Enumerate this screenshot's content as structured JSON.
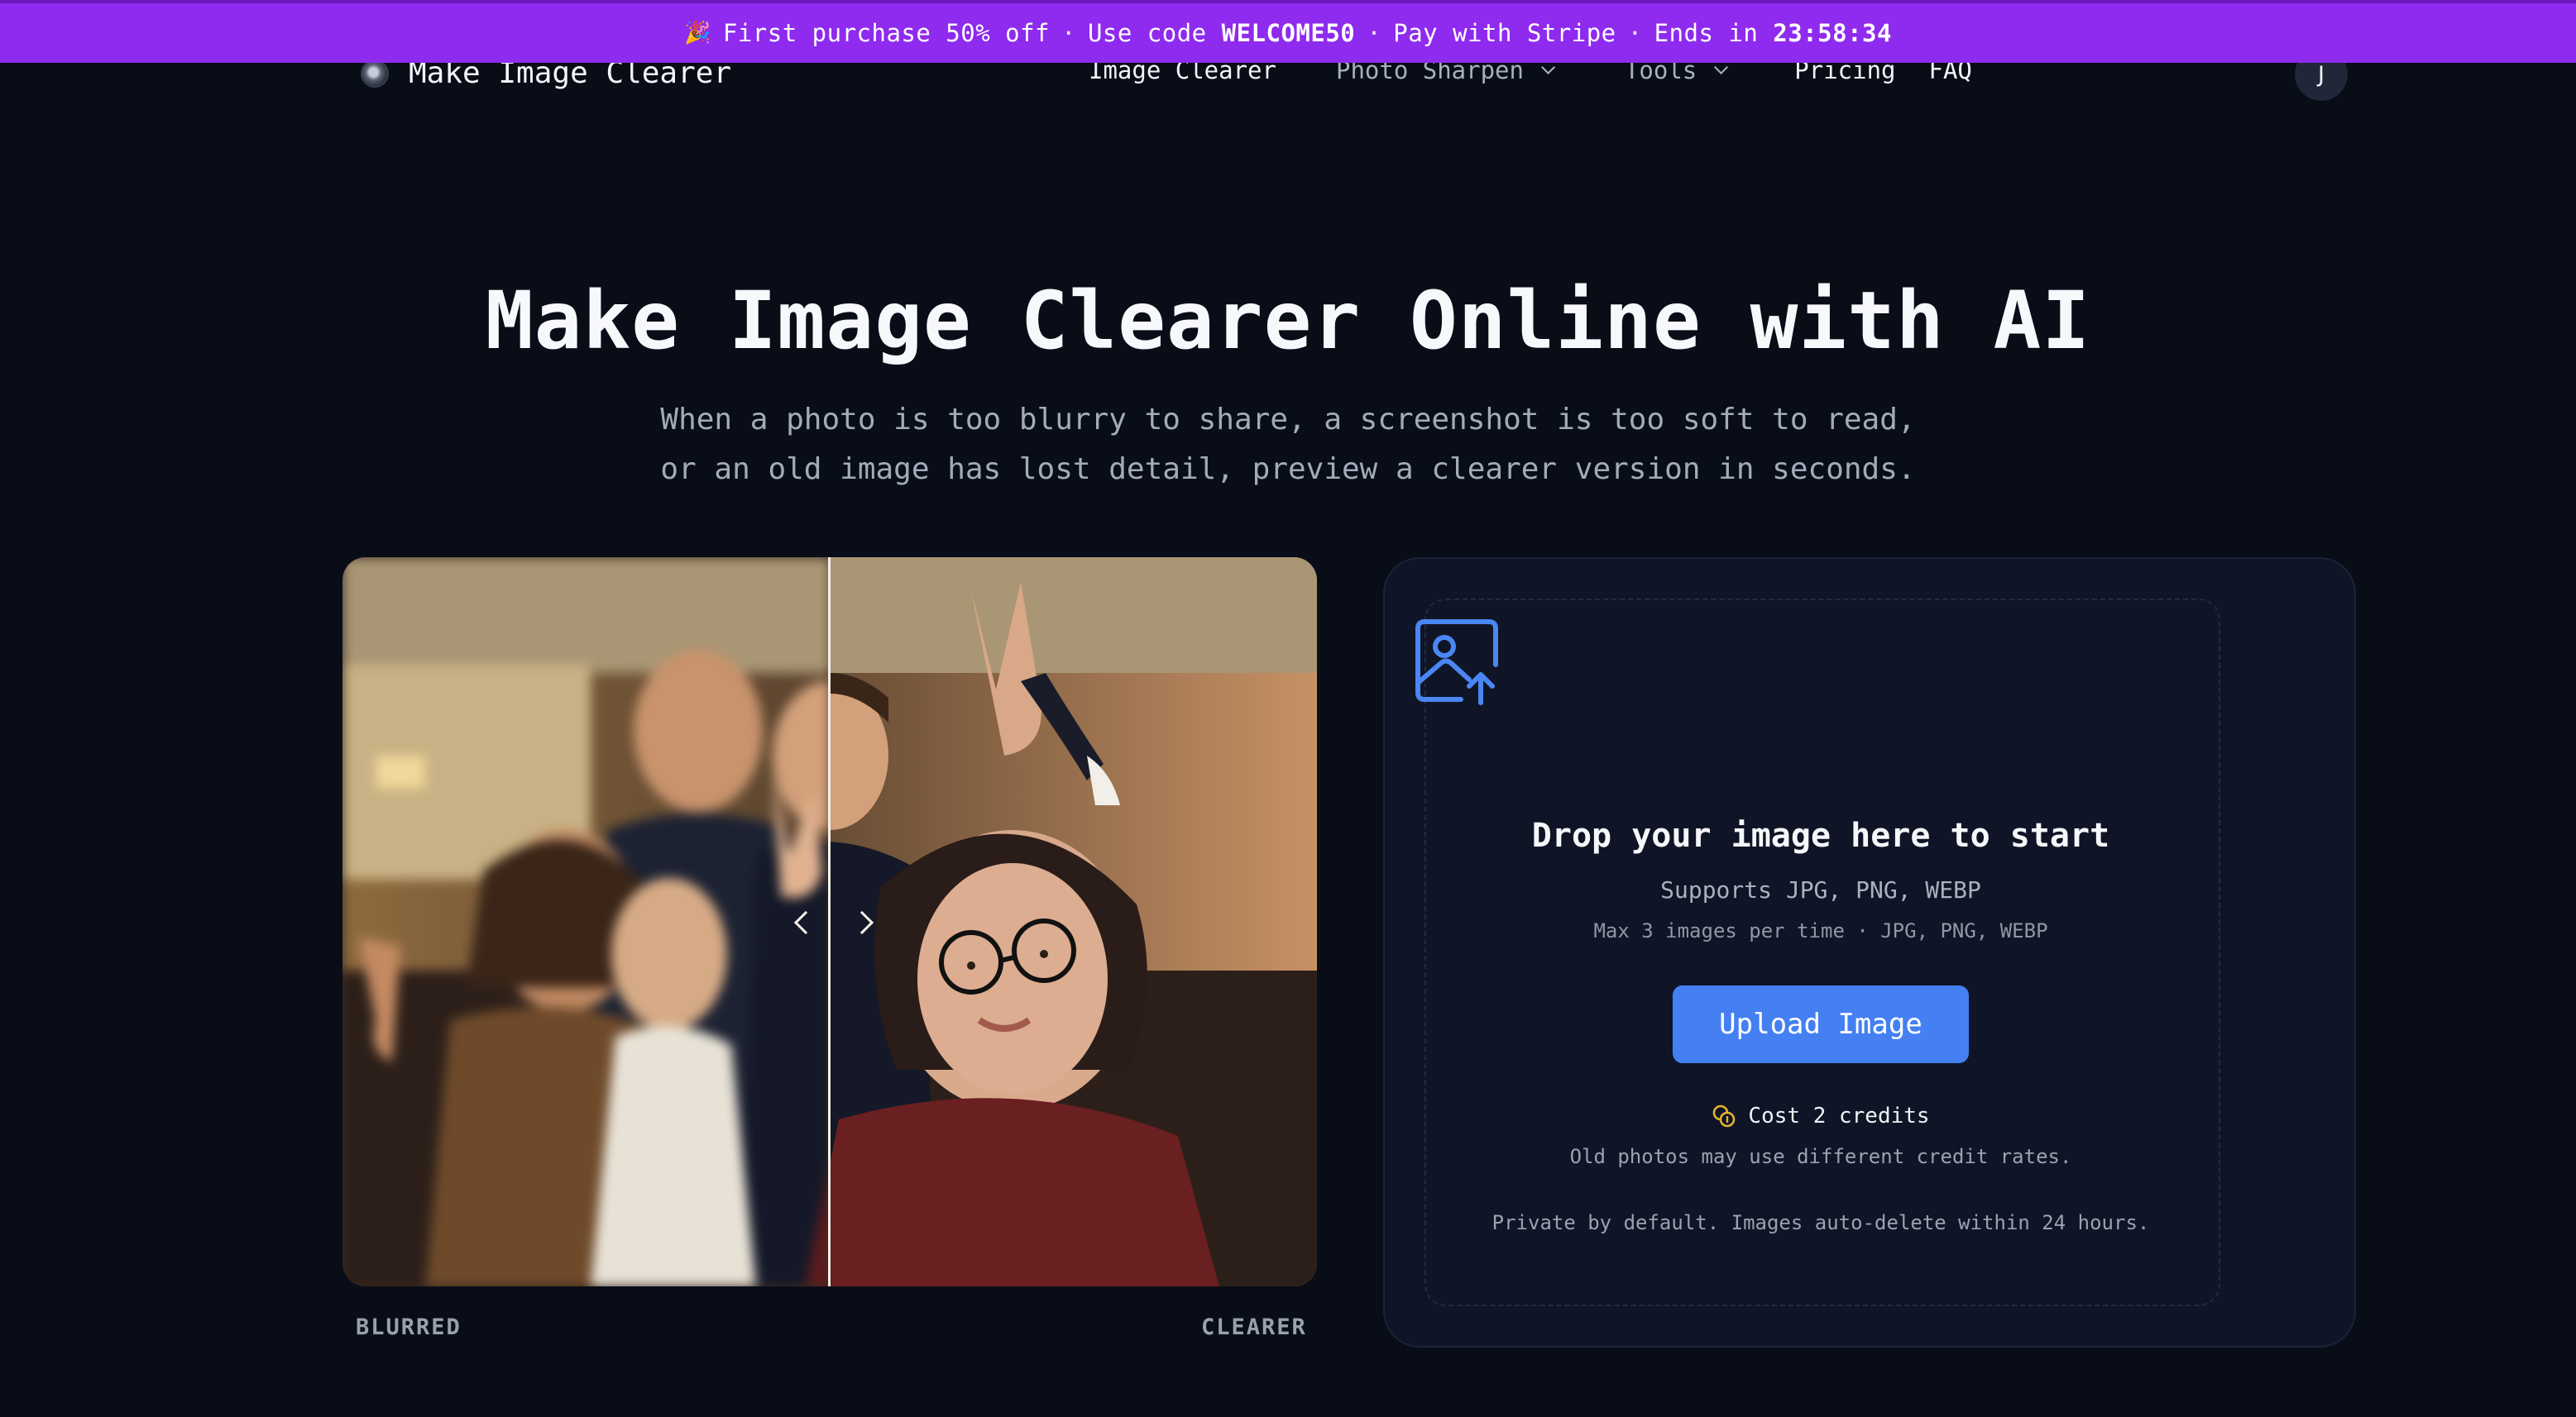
{
  "promo": {
    "emoji": "🎉",
    "offer": "First purchase 50% off",
    "code_prefix": "Use code",
    "code": "WELCOME50",
    "payment": "Pay with Stripe",
    "ends_prefix": "Ends in",
    "countdown": "23:58:34",
    "separator": "·"
  },
  "nav": {
    "brand": "Make Image Clearer",
    "links": [
      {
        "label": "Image Clearer"
      },
      {
        "label": "Photo Sharpen"
      },
      {
        "label": "Tools"
      },
      {
        "label": "Pricing"
      },
      {
        "label": "FAQ"
      }
    ],
    "avatar_initial": "J"
  },
  "hero": {
    "title": "Make Image Clearer Online with AI",
    "subtitle_line1": "When a photo is too blurry to share, a screenshot is too soft to read,",
    "subtitle_line2": "or an old image has lost detail, preview a clearer version in seconds."
  },
  "compare": {
    "left_label": "BLURRED",
    "right_label": "CLEARER",
    "slider_position": 0.5
  },
  "upload": {
    "icon": "image-upload-icon",
    "title": "Drop your image here to start",
    "supports": "Supports JPG, PNG, WEBP",
    "max": "Max 3 images per time · JPG, PNG, WEBP",
    "button": "Upload Image",
    "cost": "Cost 2 credits",
    "old_photos": "Old photos may use different credit rates.",
    "privacy": "Private by default. Images auto-delete within 24 hours."
  },
  "colors": {
    "background": "#090d18",
    "banner": "#8e2bee",
    "accent": "#4480f2",
    "coin": "#e6b32e"
  }
}
